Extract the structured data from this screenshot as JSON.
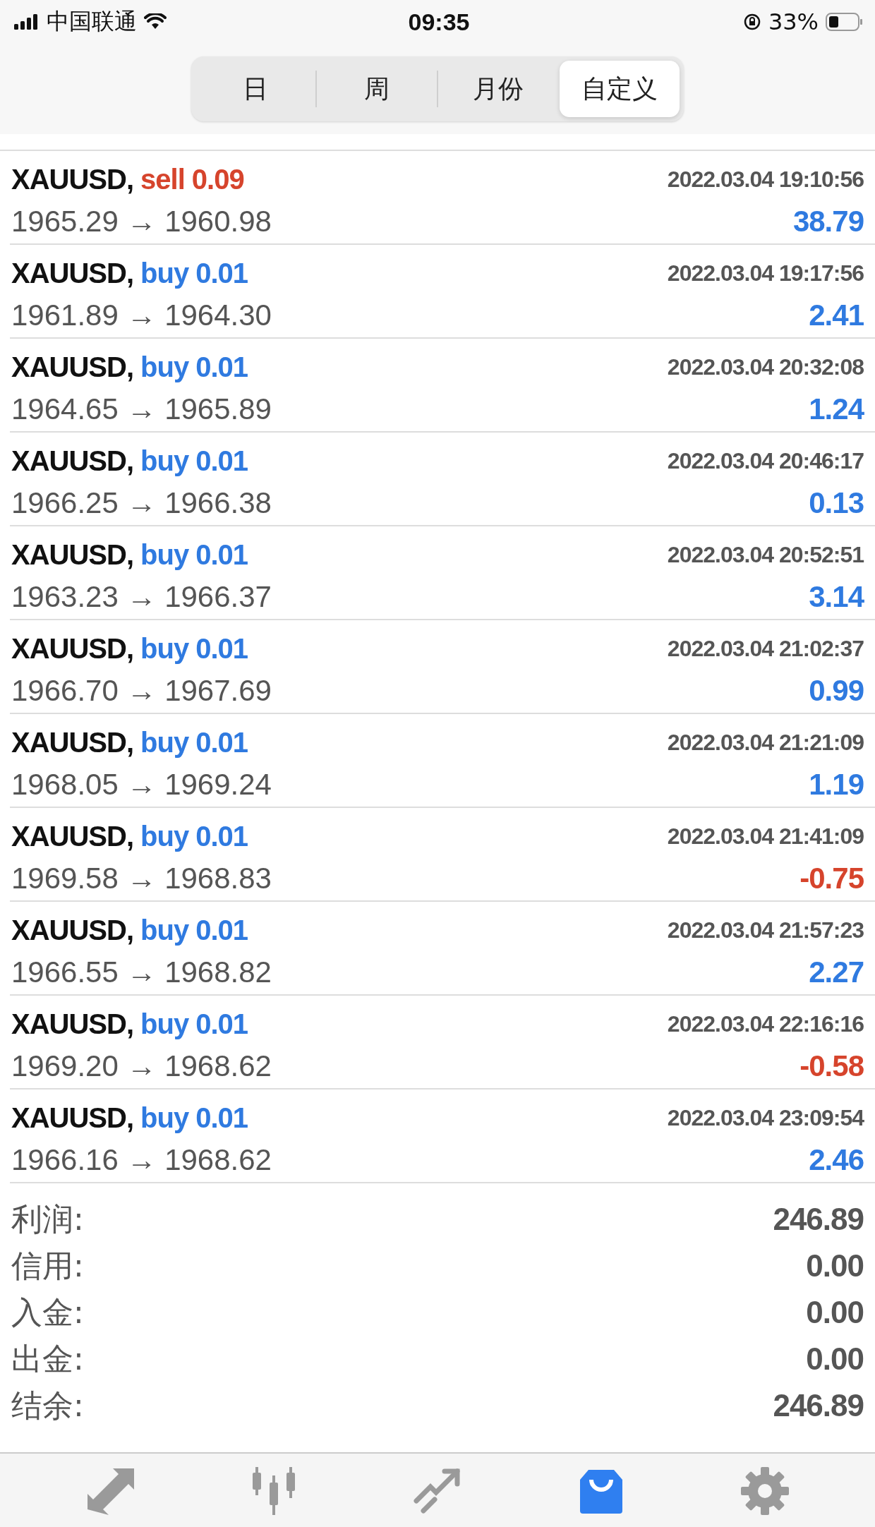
{
  "status_bar": {
    "carrier": "中国联通",
    "time": "09:35",
    "battery": "33%"
  },
  "period_tabs": [
    {
      "label": "日",
      "selected": false
    },
    {
      "label": "周",
      "selected": false
    },
    {
      "label": "月份",
      "selected": false
    },
    {
      "label": "自定义",
      "selected": true
    }
  ],
  "deals": [
    {
      "symbol": "XAUUSD,",
      "kind": "sell",
      "volume": "sell 0.09",
      "time": "2022.03.04 19:10:56",
      "prices": "1965.29 → 1960.98",
      "profit": "38.79",
      "loss": false
    },
    {
      "symbol": "XAUUSD,",
      "kind": "buy",
      "volume": "buy 0.01",
      "time": "2022.03.04 19:17:56",
      "prices": "1961.89 → 1964.30",
      "profit": "2.41",
      "loss": false
    },
    {
      "symbol": "XAUUSD,",
      "kind": "buy",
      "volume": "buy 0.01",
      "time": "2022.03.04 20:32:08",
      "prices": "1964.65 → 1965.89",
      "profit": "1.24",
      "loss": false
    },
    {
      "symbol": "XAUUSD,",
      "kind": "buy",
      "volume": "buy 0.01",
      "time": "2022.03.04 20:46:17",
      "prices": "1966.25 → 1966.38",
      "profit": "0.13",
      "loss": false
    },
    {
      "symbol": "XAUUSD,",
      "kind": "buy",
      "volume": "buy 0.01",
      "time": "2022.03.04 20:52:51",
      "prices": "1963.23 → 1966.37",
      "profit": "3.14",
      "loss": false
    },
    {
      "symbol": "XAUUSD,",
      "kind": "buy",
      "volume": "buy 0.01",
      "time": "2022.03.04 21:02:37",
      "prices": "1966.70 → 1967.69",
      "profit": "0.99",
      "loss": false
    },
    {
      "symbol": "XAUUSD,",
      "kind": "buy",
      "volume": "buy 0.01",
      "time": "2022.03.04 21:21:09",
      "prices": "1968.05 → 1969.24",
      "profit": "1.19",
      "loss": false
    },
    {
      "symbol": "XAUUSD,",
      "kind": "buy",
      "volume": "buy 0.01",
      "time": "2022.03.04 21:41:09",
      "prices": "1969.58 → 1968.83",
      "profit": "-0.75",
      "loss": true
    },
    {
      "symbol": "XAUUSD,",
      "kind": "buy",
      "volume": "buy 0.01",
      "time": "2022.03.04 21:57:23",
      "prices": "1966.55 → 1968.82",
      "profit": "2.27",
      "loss": false
    },
    {
      "symbol": "XAUUSD,",
      "kind": "buy",
      "volume": "buy 0.01",
      "time": "2022.03.04 22:16:16",
      "prices": "1969.20 → 1968.62",
      "profit": "-0.58",
      "loss": true
    },
    {
      "symbol": "XAUUSD,",
      "kind": "buy",
      "volume": "buy 0.01",
      "time": "2022.03.04 23:09:54",
      "prices": "1966.16 → 1968.62",
      "profit": "2.46",
      "loss": false
    }
  ],
  "summary": [
    {
      "label": "利润:",
      "value": "246.89"
    },
    {
      "label": "信用:",
      "value": "0.00"
    },
    {
      "label": "入金:",
      "value": "0.00"
    },
    {
      "label": "出金:",
      "value": "0.00"
    },
    {
      "label": "结余:",
      "value": "246.89"
    }
  ],
  "bottom_tabs": [
    {
      "kind": "trade",
      "selected": false
    },
    {
      "kind": "chart",
      "selected": false
    },
    {
      "kind": "analytics",
      "selected": false
    },
    {
      "kind": "history",
      "selected": true
    },
    {
      "kind": "settings",
      "selected": false
    }
  ]
}
